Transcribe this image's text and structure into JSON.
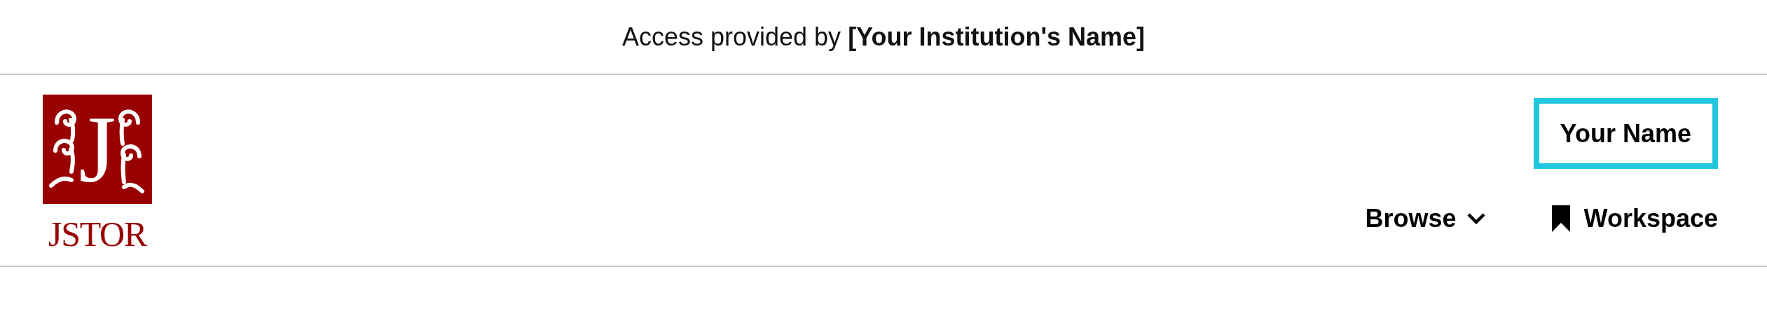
{
  "access_banner": {
    "text": "Access provided by **[Your Institution's Name]**"
  },
  "logo": {
    "letter": "J",
    "wordmark": "JSTOR"
  },
  "account": {
    "label": "Your Name",
    "highlighted": true
  },
  "nav": [
    {
      "label": "Browse",
      "kind": "dropdown"
    },
    {
      "label": "Workspace",
      "kind": "bookmark"
    }
  ]
}
